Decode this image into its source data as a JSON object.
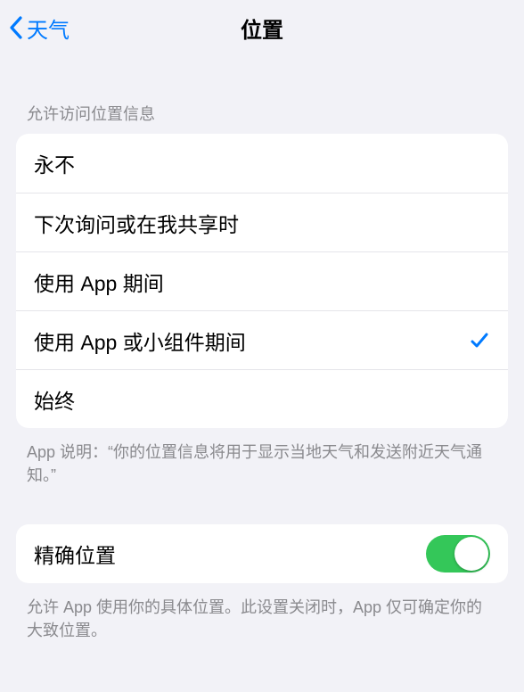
{
  "nav": {
    "back_label": "天气",
    "title": "位置"
  },
  "access": {
    "header": "允许访问位置信息",
    "options": [
      {
        "label": "永不",
        "selected": false
      },
      {
        "label": "下次询问或在我共享时",
        "selected": false
      },
      {
        "label": "使用 App 期间",
        "selected": false
      },
      {
        "label": "使用 App 或小组件期间",
        "selected": true
      },
      {
        "label": "始终",
        "selected": false
      }
    ],
    "footer": "App 说明：“你的位置信息将用于显示当地天气和发送附近天气通知。”"
  },
  "precise": {
    "label": "精确位置",
    "on": true,
    "footer": "允许 App 使用你的具体位置。此设置关闭时，App 仅可确定你的大致位置。"
  }
}
